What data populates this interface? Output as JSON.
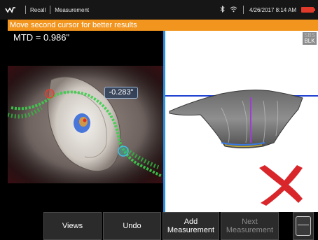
{
  "status_bar": {
    "logo_icon": "waveform-logo-icon",
    "recall_label": "Recall",
    "measurement_label": "Measurement",
    "bluetooth_icon": "bluetooth-icon",
    "wifi_icon": "wifi-icon",
    "datetime": "4/26/2017 8:14 AM",
    "battery_icon": "battery-icon",
    "battery_color": "#e23a2a"
  },
  "banner": {
    "message": "Move second cursor for better results",
    "color": "#f2951f"
  },
  "left_view": {
    "mtd_readout": "MTD = 0.986\"",
    "depth_label": "-0.283\""
  },
  "right_view": {
    "blk_top": "SBS",
    "blk_bottom": "BLK",
    "invalid_mark_icon": "red-x-icon",
    "invalid_mark_color": "#d8262b"
  },
  "buttons": {
    "views": "Views",
    "undo": "Undo",
    "add_measurement_line1": "Add",
    "add_measurement_line2": "Measurement",
    "next_measurement_line1": "Next",
    "next_measurement_line2": "Measurement",
    "more_icon": "menu-toggle-icon"
  },
  "accent_color": "#2a8fe0"
}
